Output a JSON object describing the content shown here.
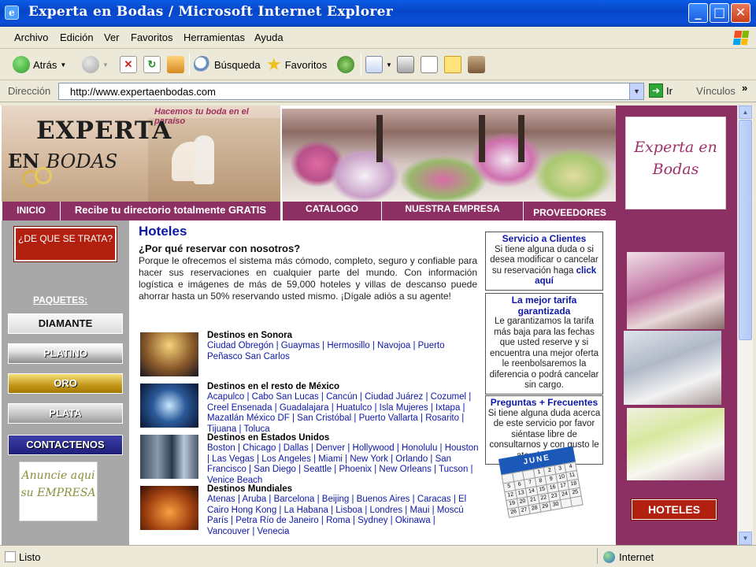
{
  "window": {
    "title": "Experta en Bodas / Microsoft Internet Explorer",
    "ie_glyph": "e"
  },
  "menu": [
    "Archivo",
    "Edición",
    "Ver",
    "Favoritos",
    "Herramientas",
    "Ayuda"
  ],
  "toolbar": {
    "back": "Atrás",
    "search": "Búsqueda",
    "favorites": "Favoritos"
  },
  "address": {
    "label": "Dirección",
    "url": "http://www.expertaenbodas.com",
    "go": "Ir",
    "links": "Vínculos"
  },
  "status": {
    "left": "Listo",
    "zone": "Internet"
  },
  "page": {
    "tagline": "Hacemos tu boda en el paraíso",
    "logo_line1": "EXPERTA",
    "logo_en": "EN",
    "logo_bodas": "BODAS",
    "nav": {
      "inicio": "INICIO",
      "gratis": "Recibe tu directorio totalmente GRATIS",
      "catalogo": "CATALOGO",
      "empresa": "NUESTRA EMPRESA",
      "proveedores": "PROVEEDORES"
    },
    "left": {
      "top_button": "¿DE QUE SE TRATA?",
      "paquetes": "PAQUETES:",
      "packages": [
        "DIAMANTE",
        "PLATINO",
        "ORO",
        "PLATA"
      ],
      "contact": "CONTACTENOS",
      "ad": "Anuncie aqui su EMPRESA"
    },
    "main": {
      "title": "Hoteles",
      "subtitle": "¿Por qué reservar con nosotros?",
      "intro": "Porque le ofrecemos el sistema más cómodo, completo, seguro y confiable para hacer sus reservaciones en cualquier parte del mundo. Con información logística e imágenes de más de 59,000 hoteles y villas de descanso puede ahorrar hasta un 50% reservando usted mismo. ¡Dígale adiós a su agente!",
      "destinations": [
        {
          "title": "Destinos en Sonora",
          "links": "Ciudad Obregón | Guaymas | Hermosillo | Navojoa | Puerto Peñasco San Carlos"
        },
        {
          "title": "Destinos en el resto de México",
          "links": "Acapulco | Cabo San Lucas | Cancún | Ciudad Juárez | Cozumel | Creel Ensenada  | Guadalajara | Huatulco | Isla Mujeres | Ixtapa | Mazatlán México DF | San Cristóbal | Puerto Vallarta | Rosarito | Tijuana | Toluca"
        },
        {
          "title": "Destinos en Estados Unidos",
          "links": "Boston | Chicago | Dallas | Denver | Hollywood | Honolulu | Houston | Las Vegas | Los Angeles | Miami | New York | Orlando | San Francisco | San Diego | Seattle | Phoenix | New Orleans | Tucson | Venice Beach"
        },
        {
          "title": "Destinos Mundiales",
          "links": "Atenas | Aruba | Barcelona | Beijing | Buenos Aires | Caracas  | El Cairo Hong Kong | La Habana | Lisboa | Londres | Maui | Moscú París | Petra Río de Janeiro | Roma | Sydney | Okinawa | Vancouver | Venecia"
        }
      ]
    },
    "boxes": {
      "servicio": {
        "title": "Servicio a Clientes",
        "text": "Si tiene alguna duda o si desea modificar o cancelar su reservación haga",
        "link": "click aquí"
      },
      "tarifa": {
        "title": "La mejor tarifa garantizada",
        "text": "Le garantizamos la tarifa más baja para las fechas que usted reserve y si encuentra una mejor oferta le reenbolsaremos la diferencia o podrá cancelar sin cargo."
      },
      "preguntas": {
        "title": "Preguntas + Frecuentes",
        "text": "Si tiene alguna duda acerca de este servicio por favor siéntase libre de consultarnos y con gusto le atenderemos."
      }
    },
    "calendar": {
      "month": "JUNE",
      "days": [
        "",
        "",
        "",
        "1",
        "2",
        "3",
        "4",
        "5",
        "6",
        "7",
        "8",
        "9",
        "10",
        "11",
        "12",
        "13",
        "14",
        "15",
        "16",
        "17",
        "18",
        "19",
        "20",
        "21",
        "22",
        "23",
        "24",
        "25",
        "26",
        "27",
        "28",
        "29",
        "30",
        "",
        ""
      ]
    },
    "right": {
      "logo": "Experta en Bodas",
      "hotels_button": "HOTELES"
    }
  }
}
